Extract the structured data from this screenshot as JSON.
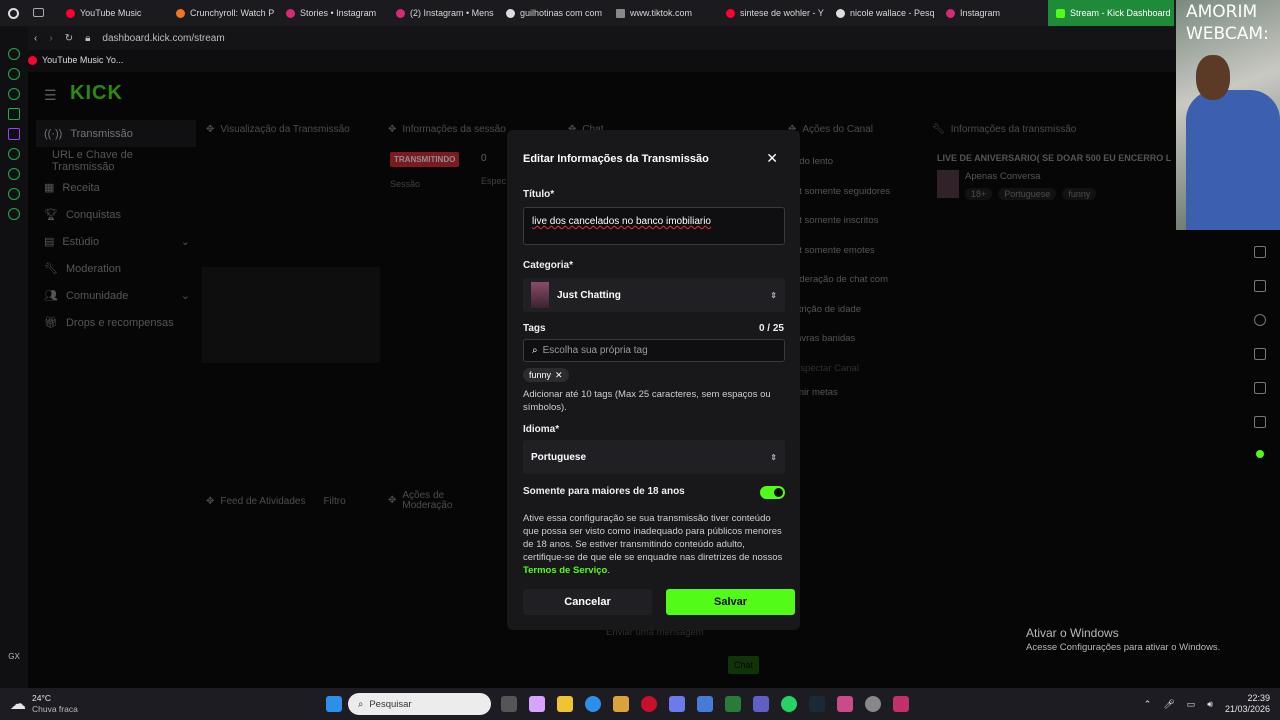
{
  "browser": {
    "tabs": [
      "YouTube Music",
      "Crunchyroll: Watch P",
      "Stories • Instagram",
      "(2) Instagram • Mens",
      "guilhotinas com com",
      "www.tiktok.com",
      "sintese de wohler - Y",
      "nicole wallace - Pesq",
      "Instagram",
      "Stream - Kick Dashboard"
    ],
    "url": "dashboard.kick.com/stream",
    "bookmark": "YouTube Music Yo..."
  },
  "webcam_overlay": {
    "line1": "AMORIM",
    "line2": "WEBCAM:"
  },
  "sidebar": {
    "items": [
      "Transmissão",
      "URL e Chave de Transmissão",
      "Receita",
      "Conquistas",
      "Estúdio",
      "Moderation",
      "Comunidade",
      "Drops e recompensas"
    ]
  },
  "panels": {
    "preview": "Visualização da Transmissão",
    "session": "Informações da sessão",
    "session_badge": "TRANSMITINDO",
    "session_label": "Sessão",
    "session_value": "0",
    "session_espec": "Espec",
    "chat": "Chat",
    "channel_actions": "Ações do Canal",
    "channel_items": [
      "odo lento",
      "at somente seguidores",
      "at somente inscritos",
      "at somente emotes",
      "oderação de chat com",
      "strição de idade",
      "lavras banidas",
      "Espectar Canal",
      "finir metas"
    ],
    "stream_info": "Informações da transmissão",
    "stream_info_title": "LIVE DE ANIVERSARIO( SE DOAR 500 EU ENCERRO L",
    "stream_info_category": "Apenas Conversa",
    "stream_info_tags": [
      "18+",
      "Portuguese",
      "funny"
    ],
    "activity": "Feed de Atividades",
    "filter": "Filtro",
    "moderation_actions": "Ações de Moderação",
    "chat_placeholder": "Enviar uma mensagem",
    "chat_button": "Chat"
  },
  "modal": {
    "title": "Editar Informações da Transmissão",
    "title_label": "Título*",
    "title_value": "live dos cancelados no banco imobiliario",
    "category_label": "Categoria*",
    "category_value": "Just Chatting",
    "tags_label": "Tags",
    "tags_count": "0 / 25",
    "tags_placeholder": "Escolha sua própria tag",
    "tag_chip": "funny",
    "tags_help": "Adicionar até 10 tags (Max 25 caracteres, sem espaços ou símbolos).",
    "language_label": "Idioma*",
    "language_value": "Portuguese",
    "adult_label": "Somente para maiores de 18 anos",
    "adult_enabled": true,
    "adult_help": "Ative essa configuração se sua transmissão tiver conteúdo que possa ser visto como inadequado para públicos menores de 18 anos. Se estiver transmitindo conteúdo adulto, certifique-se de que ele se enquadre nas diretrizes de nossos",
    "terms_link": "Termos de Serviço",
    "terms_suffix": ".",
    "cancel": "Cancelar",
    "save": "Salvar"
  },
  "windows": {
    "activate_title": "Ativar o Windows",
    "activate_sub": "Acesse Configurações para ativar o Windows.",
    "weather_temp": "24°C",
    "weather_desc": "Chuva fraca",
    "search": "Pesquisar",
    "time": "22:39",
    "date": "21/03/2026",
    "gx": "GX"
  },
  "colors": {
    "accent": "#53fc18",
    "badge_red": "#e0313b",
    "active_tab": "#1f8a3a"
  }
}
